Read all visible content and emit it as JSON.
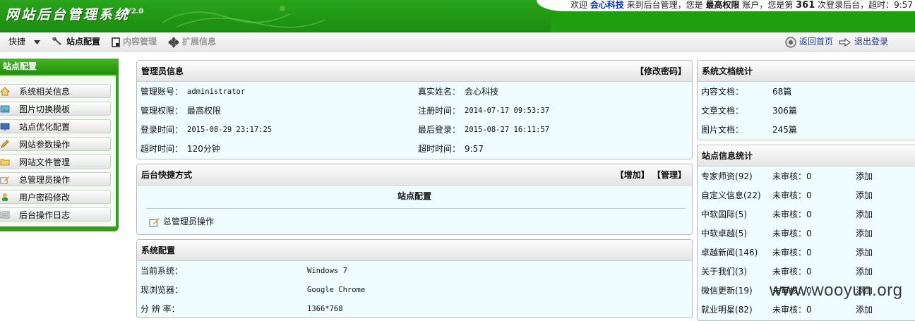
{
  "header": {
    "brand": "网站后台管理系统",
    "version": "V2.0",
    "welcome": {
      "p1": "欢迎 ",
      "company": "会心科技",
      "p2": " 来到后台管理，您是 ",
      "role": "最高权限",
      "p3": " 账户，您是第 ",
      "count": "361",
      "p4": " 次登录后台，超时：9:57"
    }
  },
  "toolbar": {
    "quick": "快捷",
    "site_config": "站点配置",
    "content_mgmt": "内容管理",
    "ext_info": "扩展信息",
    "home": "返回首页",
    "logout": "退出登录"
  },
  "sidebar": {
    "title": "站点配置",
    "items": [
      {
        "label": "系统相关信息",
        "icon": "house-icon"
      },
      {
        "label": "图片切换模板",
        "icon": "picture-icon"
      },
      {
        "label": "站点优化配置",
        "icon": "monitor-icon"
      },
      {
        "label": "网站参数操作",
        "icon": "pencil-icon"
      },
      {
        "label": "网站文件管理",
        "icon": "folder-icon"
      },
      {
        "label": "总管理员操作",
        "icon": "edit-icon"
      },
      {
        "label": "用户密码修改",
        "icon": "user-icon"
      },
      {
        "label": "后台操作日志",
        "icon": "log-icon"
      }
    ]
  },
  "admin_info": {
    "title": "管理员信息",
    "action": "【修改密码】",
    "rows": [
      {
        "l1": "管理账号：",
        "v1": "administrator",
        "l2": "真实姓名：",
        "v2": "会心科技"
      },
      {
        "l1": "管理权限：",
        "v1": "最高权限",
        "l2": "注册时间：",
        "v2": "2014-07-17 09:53:37"
      },
      {
        "l1": "登录时间：",
        "v1": "2015-08-29 23:17:25",
        "l2": "最后登录：",
        "v2": "2015-08-27 16:11:57"
      },
      {
        "l1": "超时时间：",
        "v1": "120分钟",
        "l2": "超时时间：",
        "v2": "9:57"
      }
    ]
  },
  "shortcut": {
    "title": "后台快捷方式",
    "add": "【增加】",
    "manage": "【管理】",
    "section": "站点配置",
    "item": "总管理员操作"
  },
  "sys_config": {
    "title": "系统配置",
    "rows": [
      {
        "label": "当前系统：",
        "value": "Windows 7"
      },
      {
        "label": "现浏览器：",
        "value": "Google Chrome"
      },
      {
        "label": "分 辨 率：",
        "value": "1366*768"
      }
    ]
  },
  "doc_stats": {
    "title": "系统文档统计",
    "rows": [
      {
        "label": "内容文档：",
        "value": "68篇"
      },
      {
        "label": "文章文档：",
        "value": "306篇"
      },
      {
        "label": "图片文档：",
        "value": "245篇"
      }
    ]
  },
  "site_stats": {
    "title": "站点信息统计",
    "rows": [
      {
        "name": "专家师资",
        "count": "(92)",
        "pending": "未审核：0",
        "add": "添加"
      },
      {
        "name": "自定义信息",
        "count": "(22)",
        "pending": "未审核：0",
        "add": "添加"
      },
      {
        "name": "中软国际",
        "count": "(5)",
        "pending": "未审核：0",
        "add": "添加"
      },
      {
        "name": "中软卓越",
        "count": "(5)",
        "pending": "未审核：0",
        "add": "添加"
      },
      {
        "name": "卓越新闻",
        "count": "(146)",
        "pending": "未审核：0",
        "add": "添加"
      },
      {
        "name": "关于我们",
        "count": "(3)",
        "pending": "未审核：0",
        "add": "添加"
      },
      {
        "name": "微信更新",
        "count": "(19)",
        "pending": "未审核：0",
        "add": "添加"
      },
      {
        "name": "就业明星",
        "count": "(82)",
        "pending": "未审核：0",
        "add": "添加"
      }
    ]
  },
  "watermark": "www.wooyun.org"
}
